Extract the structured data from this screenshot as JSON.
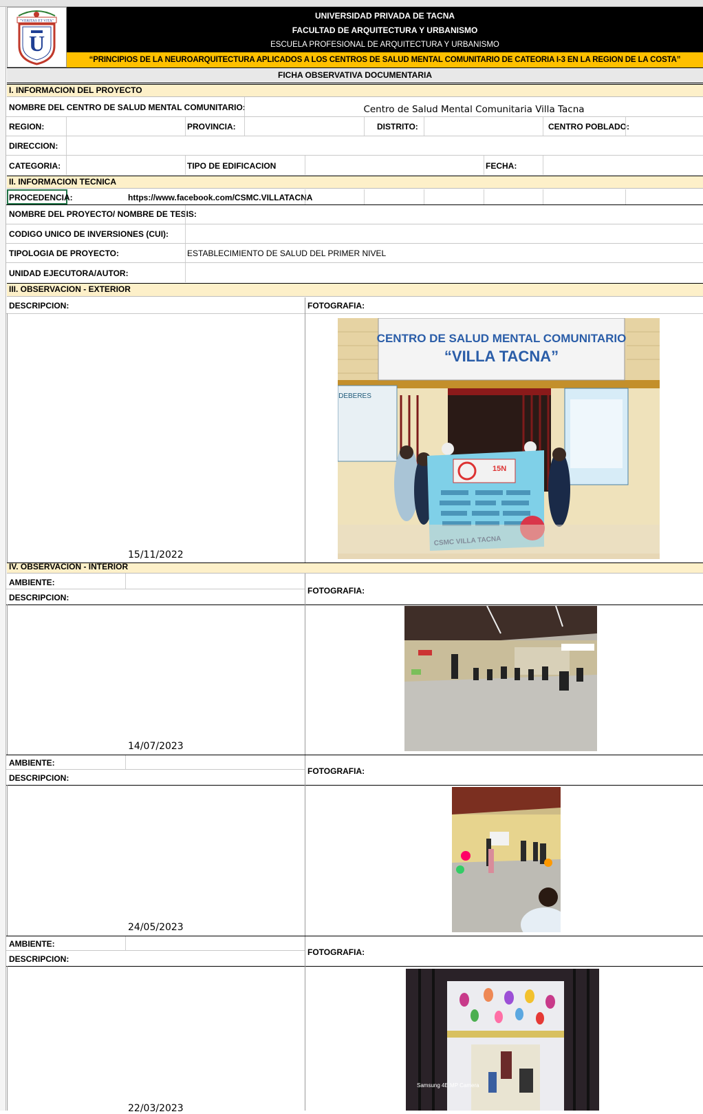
{
  "header": {
    "university": "UNIVERSIDAD PRIVADA DE TACNA",
    "faculty": "FACULTAD DE ARQUITECTURA Y URBANISMO",
    "school": "ESCUELA PROFESIONAL DE ARQUITECTURA Y URBANISMO",
    "thesis_title": "“PRINCIPIOS DE LA NEUROARQUITECTURA APLICADOS A LOS CENTROS DE SALUD MENTAL COMUNITARIO DE CATEORIA I-3 EN LA REGION DE LA COSTA”",
    "form_title": "FICHA OBSERVATIVA DOCUMENTARIA",
    "logo": {
      "motto": "\"VERITAS ET VITA\"",
      "ring_text": "UNIVERSIDAD PRIVADA DE TACNA",
      "letter": "U"
    },
    "colors": {
      "black_band": "#000000",
      "yellow_band": "#ffc000",
      "section_fill": "#fdf0c9",
      "logo_red": "#c0392b",
      "logo_blue": "#1f3f94"
    }
  },
  "section1": {
    "title": "I. INFORMACION DEL PROYECTO",
    "center_name_label": "NOMBRE DEL CENTRO DE SALUD MENTAL COMUNITARIO:",
    "center_name_value": "Centro de Salud Mental Comunitaria Villa Tacna",
    "region_label": "REGION:",
    "provincia_label": "PROVINCIA:",
    "distrito_label": "DISTRITO:",
    "centro_poblado_label": "CENTRO POBLADO:",
    "direccion_label": "DIRECCION:",
    "categoria_label": "CATEGORIA:",
    "tipo_edificacion_label": "TIPO DE EDIFICACION",
    "fecha_label": "FECHA:"
  },
  "section2": {
    "title": "II. INFORMACION TECNICA",
    "procedencia_label": "PROCEDENCIA:",
    "procedencia_value": "https://www.facebook.com/CSMC.VILLATACNA",
    "nombre_proyecto_label": "NOMBRE DEL PROYECTO/ NOMBRE DE TESIS:",
    "cui_label": "CODIGO UNICO DE INVERSIONES (CUI):",
    "tipologia_label": "TIPOLOGIA DE PROYECTO:",
    "tipologia_value": "ESTABLECIMIENTO DE SALUD DEL PRIMER NIVEL",
    "unidad_label": "UNIDAD EJECUTORA/AUTOR:"
  },
  "section3": {
    "title": "III. OBSERVACION - EXTERIOR",
    "descripcion_label": "DESCRIPCION:",
    "fotografia_label": "FOTOGRAFIA:",
    "date": "15/11/2022",
    "photo": {
      "sign_line1": "CENTRO DE SALUD MENTAL COMUNITARIO",
      "sign_line2": "“VILLA TACNA”",
      "left_poster": "DEBERES",
      "banner_text": "CSMC VILLA TACNA",
      "banner_badge": "15N"
    }
  },
  "section4": {
    "title": "IV. OBSERVACION - INTERIOR",
    "entries": [
      {
        "ambiente_label": "AMBIENTE:",
        "descripcion_label": "DESCRIPCION:",
        "fotografia_label": "FOTOGRAFIA:",
        "date": "14/07/2023"
      },
      {
        "ambiente_label": "AMBIENTE:",
        "descripcion_label": "DESCRIPCION:",
        "fotografia_label": "FOTOGRAFIA:",
        "date": "24/05/2023"
      },
      {
        "ambiente_label": "AMBIENTE:",
        "descripcion_label": "DESCRIPCION:",
        "fotografia_label": "FOTOGRAFIA:",
        "date": "22/03/2023",
        "photo_caption": "Samsung 4E MP Camera"
      }
    ]
  }
}
